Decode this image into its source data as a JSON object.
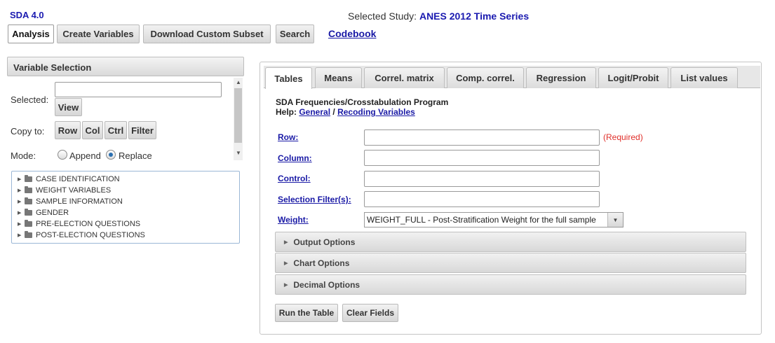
{
  "header": {
    "app_title": "SDA 4.0",
    "study_label": "Selected Study:",
    "study_name": "ANES 2012 Time Series"
  },
  "topnav": {
    "analysis": "Analysis",
    "create_variables": "Create Variables",
    "download_subset": "Download Custom Subset",
    "search": "Search",
    "codebook": "Codebook"
  },
  "variable_panel": {
    "title": "Variable Selection",
    "selected_label": "Selected:",
    "selected_value": "",
    "view": "View",
    "copy_to_label": "Copy to:",
    "copy_buttons": [
      "Row",
      "Col",
      "Ctrl",
      "Filter"
    ],
    "mode_label": "Mode:",
    "mode_append": "Append",
    "mode_replace": "Replace",
    "mode_selected": "Replace",
    "tree": [
      "CASE IDENTIFICATION",
      "WEIGHT VARIABLES",
      "SAMPLE INFORMATION",
      "GENDER",
      "PRE-ELECTION QUESTIONS",
      "POST-ELECTION QUESTIONS"
    ]
  },
  "tabs": [
    "Tables",
    "Means",
    "Correl. matrix",
    "Comp. correl.",
    "Regression",
    "Logit/Probit",
    "List values"
  ],
  "active_tab": "Tables",
  "program": {
    "title": "SDA Frequencies/Crosstabulation Program",
    "help_label": "Help:",
    "help_general": "General",
    "help_sep": "/",
    "help_recoding": "Recoding Variables"
  },
  "form": {
    "row_label": "Row:",
    "row_value": "",
    "required": "(Required)",
    "column_label": "Column:",
    "column_value": "",
    "control_label": "Control:",
    "control_value": "",
    "filter_label": "Selection Filter(s):",
    "filter_value": "",
    "weight_label": "Weight:",
    "weight_value": "WEIGHT_FULL - Post-Stratification Weight for the full sample"
  },
  "sections": [
    "Output Options",
    "Chart Options",
    "Decimal Options"
  ],
  "actions": {
    "run": "Run the Table",
    "clear": "Clear Fields"
  }
}
